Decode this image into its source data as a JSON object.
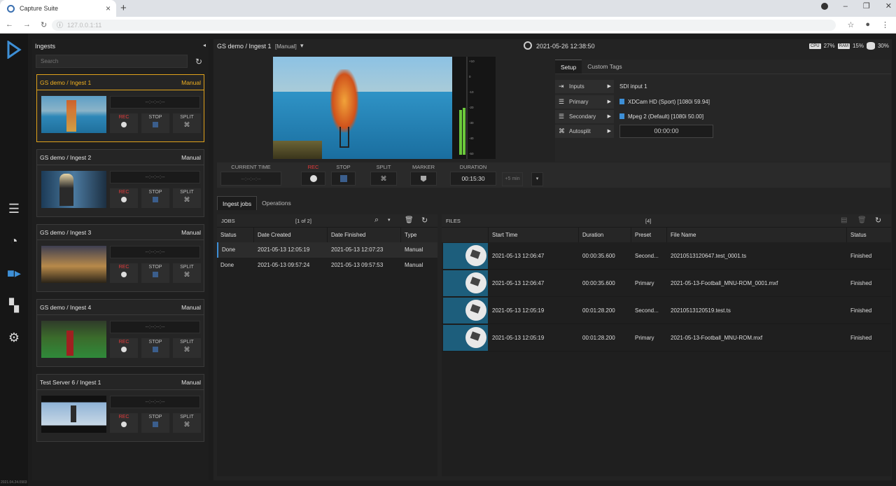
{
  "browser": {
    "tab_title": "Capture Suite",
    "url": "127.0.0.1:11"
  },
  "app": {
    "version": "2021.04.24.0903"
  },
  "ingests": {
    "title": "Ingests",
    "search_placeholder": "Search",
    "cards": [
      {
        "name": "GS demo / Ingest 1",
        "mode": "Manual",
        "timecode": "--:--:--:--",
        "rec": "REC",
        "stop": "STOP",
        "split": "SPLIT"
      },
      {
        "name": "GS demo / Ingest 2",
        "mode": "Manual",
        "timecode": "--:--:--:--",
        "rec": "REC",
        "stop": "STOP",
        "split": "SPLIT"
      },
      {
        "name": "GS demo / Ingest 3",
        "mode": "Manual",
        "timecode": "--:--:--:--",
        "rec": "REC",
        "stop": "STOP",
        "split": "SPLIT"
      },
      {
        "name": "GS demo / Ingest 4",
        "mode": "Manual",
        "timecode": "--:--:--:--",
        "rec": "REC",
        "stop": "STOP",
        "split": "SPLIT"
      },
      {
        "name": "Test Server 6 / Ingest 1",
        "mode": "Manual",
        "timecode": "--:--:--:--",
        "rec": "REC",
        "stop": "STOP",
        "split": "SPLIT"
      }
    ]
  },
  "header": {
    "source": "GS demo / Ingest 1",
    "mode": "[Manual]",
    "datetime": "2021-05-26 12:38:50",
    "cpu_label": "CPU",
    "cpu": "27%",
    "ram_label": "RAM",
    "ram": "15%",
    "disk": "30%"
  },
  "meter": {
    "scale": [
      "+10",
      "0",
      "-10",
      "-20",
      "-30",
      "-40",
      "-50"
    ],
    "levels": [
      0.48,
      0.5
    ]
  },
  "setup": {
    "tabs": [
      "Setup",
      "Custom Tags"
    ],
    "rows": [
      {
        "label": "Inputs",
        "value": "SDI input 1"
      },
      {
        "label": "Primary",
        "value": "XDCam HD (Sport) [1080i 59.94]"
      },
      {
        "label": "Secondary",
        "value": "Mpeg 2 (Default) [1080i 50.00]"
      },
      {
        "label": "Autosplit",
        "value": "00:00:00"
      }
    ]
  },
  "transport": {
    "current_time_label": "CURRENT TIME",
    "current_time": "--:--:--:--",
    "rec": "REC",
    "stop": "STOP",
    "split": "SPLIT",
    "marker": "MARKER",
    "duration_label": "DURATION",
    "duration": "00:15:30",
    "plus5": "+5 min"
  },
  "bottom_tabs": [
    "Ingest jobs",
    "Operations"
  ],
  "jobs": {
    "title": "JOBS",
    "pager": "[1 of 2]",
    "columns": [
      "Status",
      "Date Created",
      "Date Finished",
      "Type"
    ],
    "rows": [
      [
        "Done",
        "2021-05-13 12:05:19",
        "2021-05-13 12:07:23",
        "Manual"
      ],
      [
        "Done",
        "2021-05-13 09:57:24",
        "2021-05-13 09:57:53",
        "Manual"
      ]
    ]
  },
  "files": {
    "title": "FILES",
    "count": "[4]",
    "columns": [
      "",
      "Start Time",
      "Duration",
      "Preset",
      "File Name",
      "Status"
    ],
    "rows": [
      [
        "2021-05-13 12:06:47",
        "00:00:35.600",
        "Second...",
        "20210513120647.test_0001.ts",
        "Finished"
      ],
      [
        "2021-05-13 12:06:47",
        "00:00:35.600",
        "Primary",
        "2021-05-13-Football_MNU-ROM_0001.mxf",
        "Finished"
      ],
      [
        "2021-05-13 12:05:19",
        "00:01:28.200",
        "Second...",
        "20210513120519.test.ts",
        "Finished"
      ],
      [
        "2021-05-13 12:05:19",
        "00:01:28.200",
        "Primary",
        "2021-05-13-Football_MNU-ROM.mxf",
        "Finished"
      ]
    ]
  }
}
